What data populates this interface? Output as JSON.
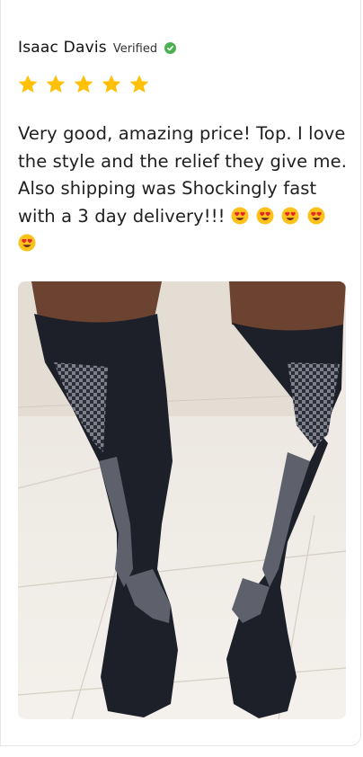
{
  "review": {
    "author": "Isaac Davis",
    "verified_label": "Verified",
    "rating": 5,
    "body": "Very good, amazing price! Top. I love the style and the relief they give me. Also shipping was Shockingly fast with a 3 day delivery!!!",
    "emojis": [
      "heart-eyes",
      "heart-eyes",
      "heart-eyes",
      "heart-eyes",
      "heart-eyes"
    ],
    "photo_subject": "knee-high black compression socks"
  },
  "colors": {
    "star": "#ffc107",
    "verified_check": "#4caf50"
  }
}
